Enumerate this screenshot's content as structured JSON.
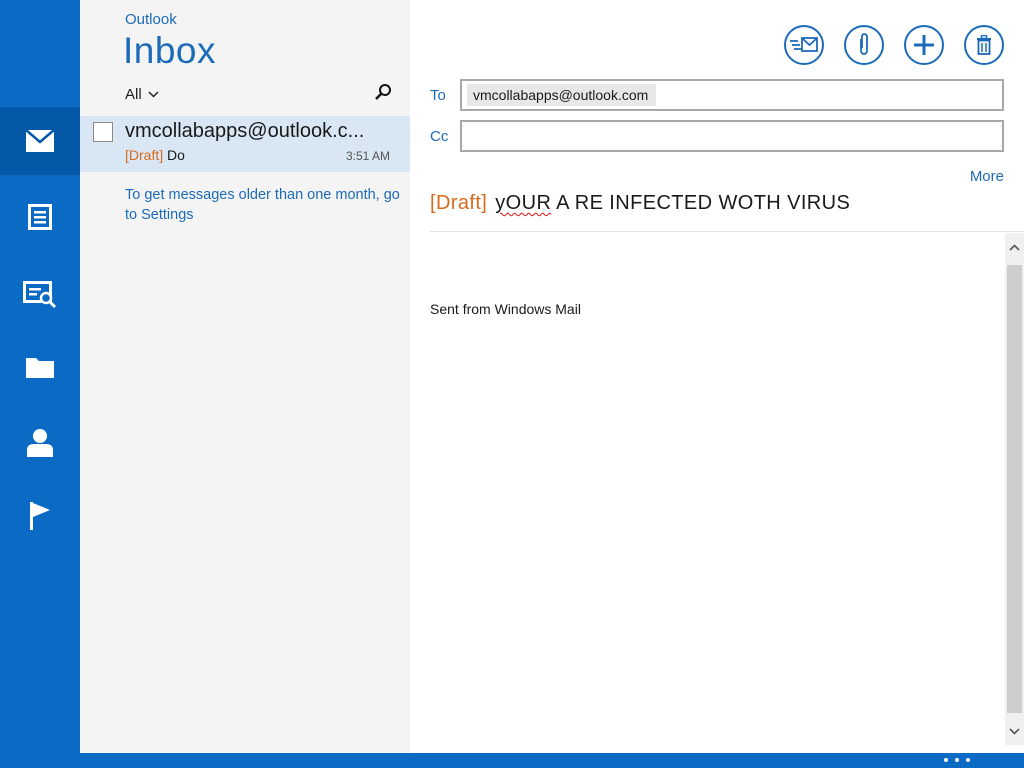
{
  "nav": {
    "items": [
      {
        "name": "mail-icon",
        "active": true
      },
      {
        "name": "news-icon",
        "active": false
      },
      {
        "name": "search-messages-icon",
        "active": false
      },
      {
        "name": "folder-icon",
        "active": false
      },
      {
        "name": "people-icon",
        "active": false
      },
      {
        "name": "flag-icon",
        "active": false
      }
    ]
  },
  "list": {
    "account": "Outlook",
    "folder_title": "Inbox",
    "filter_label": "All",
    "search_icon": "search-icon",
    "messages": [
      {
        "sender": "vmcollabapps@outlook.c...",
        "tag": "[Draft]",
        "preview": "Do",
        "time": "3:51 AM"
      }
    ],
    "older_note": "To get messages older than one month, go to Settings"
  },
  "compose": {
    "toolbar": [
      "send-icon",
      "attach-icon",
      "add-icon",
      "delete-icon"
    ],
    "to_label": "To",
    "to_value": "vmcollabapps@outlook.com",
    "cc_label": "Cc",
    "cc_value": "",
    "more_label": "More",
    "subject_tag": "[Draft]",
    "subject_first_word": "yOUR",
    "subject_rest": "A RE INFECTED WOTH VIRUS",
    "body": "Sent from Windows Mail"
  },
  "appbar": {
    "more_icon": "ellipsis-icon"
  },
  "colors": {
    "accent": "#0b6ac4",
    "accent_dark": "#0557a8",
    "link": "#1d6bb8",
    "draft": "#d86a1e",
    "selected_row": "#d9e7f4",
    "list_bg": "#f4f4f4"
  }
}
